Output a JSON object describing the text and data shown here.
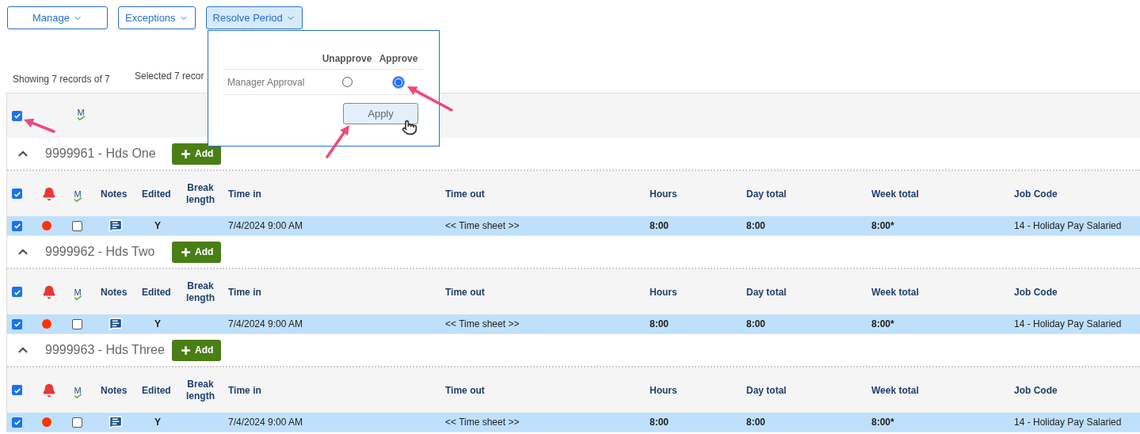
{
  "toolbar": [
    {
      "label": "Manage",
      "active": false
    },
    {
      "label": "Exceptions",
      "active": false
    },
    {
      "label": "Resolve Period",
      "active": true
    }
  ],
  "summary": {
    "showing": "Showing 7 records of 7",
    "selected": "Selected 7 recor"
  },
  "select_all": {
    "checked": true,
    "approval_icon_label": "M"
  },
  "popup": {
    "columns": [
      "Unapprove",
      "Approve"
    ],
    "row_label": "Manager Approval",
    "options": [
      {
        "selected": false
      },
      {
        "selected": true
      }
    ],
    "apply": "Apply"
  },
  "groups": [
    {
      "title": "9999961 - Hds One",
      "expanded": true,
      "add": "Add",
      "header_checked": true,
      "approval_icon_label": "M",
      "columns": [
        "Notes",
        "Edited",
        "Break length",
        "Time in",
        "Time out",
        "Hours",
        "Day total",
        "Week total",
        "Job Code"
      ],
      "row": {
        "selected": true,
        "checked": true,
        "color": "#ff3300",
        "approved": false,
        "edited": "Y",
        "time_in": "7/4/2024 9:00 AM",
        "time_out": "<< Time sheet >>",
        "hours": "8:00",
        "day_total": "8:00",
        "week_total": "8:00*",
        "job_code": "14 - Holiday Pay Salaried"
      }
    },
    {
      "title": "9999962 - Hds Two",
      "expanded": true,
      "add": "Add",
      "header_checked": true,
      "approval_icon_label": "M",
      "columns": [
        "Notes",
        "Edited",
        "Break length",
        "Time in",
        "Time out",
        "Hours",
        "Day total",
        "Week total",
        "Job Code"
      ],
      "row": {
        "selected": true,
        "checked": true,
        "color": "#ff3300",
        "approved": false,
        "edited": "Y",
        "time_in": "7/4/2024 9:00 AM",
        "time_out": "<< Time sheet >>",
        "hours": "8:00",
        "day_total": "8:00",
        "week_total": "8:00*",
        "job_code": "14 - Holiday Pay Salaried"
      }
    },
    {
      "title": "9999963 - Hds Three",
      "expanded": true,
      "add": "Add",
      "header_checked": true,
      "approval_icon_label": "M",
      "columns": [
        "Notes",
        "Edited",
        "Break length",
        "Time in",
        "Time out",
        "Hours",
        "Day total",
        "Week total",
        "Job Code"
      ],
      "row": {
        "selected": true,
        "checked": true,
        "color": "#ff3300",
        "approved": false,
        "edited": "Y",
        "time_in": "7/4/2024 9:00 AM",
        "time_out": "<< Time sheet >>",
        "hours": "8:00",
        "day_total": "8:00",
        "week_total": "8:00*",
        "job_code": "14 - Holiday Pay Salaried"
      }
    }
  ]
}
